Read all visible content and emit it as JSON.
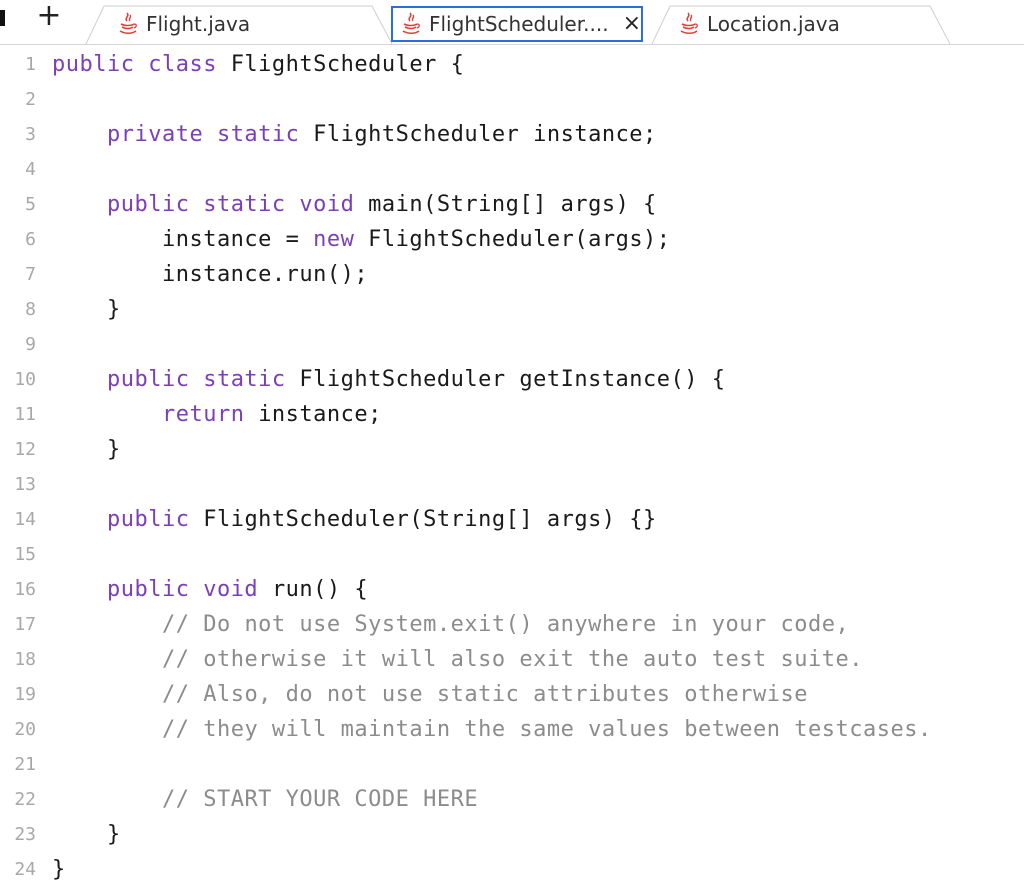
{
  "tabs": [
    {
      "label": "Flight.java",
      "active": false,
      "icon": "java-icon"
    },
    {
      "label": "FlightScheduler....",
      "active": true,
      "icon": "java-icon",
      "close": "×"
    },
    {
      "label": "Location.java",
      "active": false,
      "icon": "java-icon"
    }
  ],
  "new_tab_label": "+",
  "colors": {
    "keyword": "#7b3fb8",
    "comment": "#8c8c8c",
    "active_tab_border": "#2b6fdc",
    "line_number": "#a8a8a8"
  },
  "code_lines": [
    {
      "n": "1",
      "segs": [
        [
          "kw",
          "public class "
        ],
        [
          "tx",
          "FlightScheduler {"
        ]
      ]
    },
    {
      "n": "2",
      "segs": []
    },
    {
      "n": "3",
      "segs": [
        [
          "tx",
          "    "
        ],
        [
          "kw",
          "private static "
        ],
        [
          "tx",
          "FlightScheduler instance;"
        ]
      ]
    },
    {
      "n": "4",
      "segs": []
    },
    {
      "n": "5",
      "segs": [
        [
          "tx",
          "    "
        ],
        [
          "kw",
          "public static void "
        ],
        [
          "tx",
          "main(String[] args) {"
        ]
      ]
    },
    {
      "n": "6",
      "segs": [
        [
          "tx",
          "        instance = "
        ],
        [
          "kw",
          "new "
        ],
        [
          "tx",
          "FlightScheduler(args);"
        ]
      ]
    },
    {
      "n": "7",
      "segs": [
        [
          "tx",
          "        instance.run();"
        ]
      ]
    },
    {
      "n": "8",
      "segs": [
        [
          "tx",
          "    }"
        ]
      ]
    },
    {
      "n": "9",
      "segs": []
    },
    {
      "n": "10",
      "segs": [
        [
          "tx",
          "    "
        ],
        [
          "kw",
          "public static "
        ],
        [
          "tx",
          "FlightScheduler getInstance() {"
        ]
      ]
    },
    {
      "n": "11",
      "segs": [
        [
          "tx",
          "        "
        ],
        [
          "kw",
          "return "
        ],
        [
          "tx",
          "instance;"
        ]
      ]
    },
    {
      "n": "12",
      "segs": [
        [
          "tx",
          "    }"
        ]
      ]
    },
    {
      "n": "13",
      "segs": []
    },
    {
      "n": "14",
      "segs": [
        [
          "tx",
          "    "
        ],
        [
          "kw",
          "public "
        ],
        [
          "tx",
          "FlightScheduler(String[] args) {}"
        ]
      ]
    },
    {
      "n": "15",
      "segs": []
    },
    {
      "n": "16",
      "segs": [
        [
          "tx",
          "    "
        ],
        [
          "kw",
          "public void "
        ],
        [
          "tx",
          "run() {"
        ]
      ]
    },
    {
      "n": "17",
      "segs": [
        [
          "tx",
          "        "
        ],
        [
          "cm",
          "// Do not use System.exit() anywhere in your code,"
        ]
      ]
    },
    {
      "n": "18",
      "segs": [
        [
          "tx",
          "        "
        ],
        [
          "cm",
          "// otherwise it will also exit the auto test suite."
        ]
      ]
    },
    {
      "n": "19",
      "segs": [
        [
          "tx",
          "        "
        ],
        [
          "cm",
          "// Also, do not use static attributes otherwise"
        ]
      ]
    },
    {
      "n": "20",
      "segs": [
        [
          "tx",
          "        "
        ],
        [
          "cm",
          "// they will maintain the same values between testcases."
        ]
      ]
    },
    {
      "n": "21",
      "segs": []
    },
    {
      "n": "22",
      "segs": [
        [
          "tx",
          "        "
        ],
        [
          "cm",
          "// START YOUR CODE HERE"
        ]
      ]
    },
    {
      "n": "23",
      "segs": [
        [
          "tx",
          "    }"
        ]
      ]
    },
    {
      "n": "24",
      "segs": [
        [
          "tx",
          "}"
        ]
      ]
    }
  ]
}
